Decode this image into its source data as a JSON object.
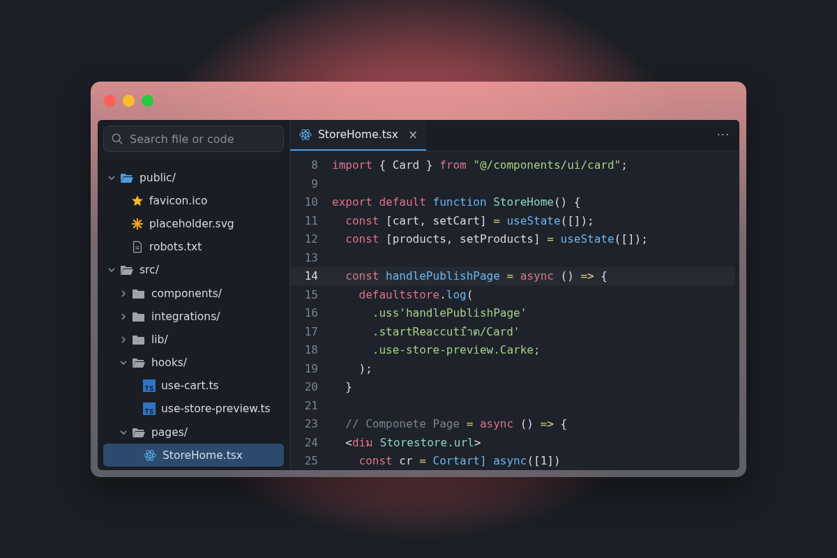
{
  "window": {
    "controls": [
      {
        "kind": "close"
      },
      {
        "kind": "minimize"
      },
      {
        "kind": "zoom"
      }
    ]
  },
  "sidebar": {
    "search": {
      "placeholder": "Search file or code"
    },
    "tree": [
      {
        "name": "public/",
        "kind": "folder",
        "color": "#4d9de0",
        "expanded": true,
        "selected": false,
        "children": [
          {
            "name": "favicon.ico",
            "kind": "star",
            "selected": false
          },
          {
            "name": "placeholder.svg",
            "kind": "asterisk",
            "selected": false
          },
          {
            "name": "robots.txt",
            "kind": "text",
            "selected": false
          }
        ]
      },
      {
        "name": "src/",
        "kind": "folder",
        "color": "#9ea3ab",
        "expanded": true,
        "selected": false,
        "children": [
          {
            "name": "components/",
            "kind": "folder",
            "color": "#9ea3ab",
            "expanded": false,
            "selected": false
          },
          {
            "name": "integrations/",
            "kind": "folder",
            "color": "#9ea3ab",
            "expanded": false,
            "selected": false
          },
          {
            "name": "lib/",
            "kind": "folder",
            "color": "#9ea3ab",
            "expanded": false,
            "selected": false
          },
          {
            "name": "hooks/",
            "kind": "folder",
            "color": "#9ea3ab",
            "expanded": true,
            "selected": false,
            "children": [
              {
                "name": "use-cart.ts",
                "kind": "ts",
                "selected": false
              },
              {
                "name": "use-store-preview.ts",
                "kind": "ts",
                "selected": false
              }
            ]
          },
          {
            "name": "pages/",
            "kind": "folder",
            "color": "#9ea3ab",
            "expanded": true,
            "selected": false,
            "children": [
              {
                "name": "StoreHome.tsx",
                "kind": "react",
                "selected": true
              }
            ]
          }
        ]
      }
    ]
  },
  "editor": {
    "tabs": [
      {
        "label": "StoreHome.tsx",
        "selected": true,
        "close": "×"
      }
    ],
    "more": "···",
    "lines": [
      {
        "number": "8",
        "current": false,
        "tokens": [
          {
            "text": "import",
            "kind": "kw"
          },
          {
            "text": " { Card } ",
            "kind": "plain"
          },
          {
            "text": "from",
            "kind": "kw"
          },
          {
            "text": " \"@/components/ui/card\"",
            "kind": "str"
          },
          {
            "text": ";",
            "kind": "plain"
          }
        ]
      },
      {
        "number": "9",
        "current": false
      },
      {
        "number": "10",
        "current": false,
        "tokens": [
          {
            "text": "export default ",
            "kind": "kw"
          },
          {
            "text": "function ",
            "kind": "fn"
          },
          {
            "text": "StoreHome",
            "kind": "type"
          },
          {
            "text": "() {",
            "kind": "plain"
          }
        ]
      },
      {
        "number": "11",
        "current": false,
        "tokens": [
          {
            "text": "  const",
            "kind": "kw"
          },
          {
            "text": " [cart, setCart] ",
            "kind": "plain"
          },
          {
            "text": "=",
            "kind": "op"
          },
          {
            "text": " useState",
            "kind": "fn"
          },
          {
            "text": "([]);",
            "kind": "plain"
          }
        ]
      },
      {
        "number": "12",
        "current": false,
        "tokens": [
          {
            "text": "  const",
            "kind": "kw"
          },
          {
            "text": " [products, setProducts] ",
            "kind": "plain"
          },
          {
            "text": "=",
            "kind": "op"
          },
          {
            "text": " useState",
            "kind": "fn"
          },
          {
            "text": "([]);",
            "kind": "plain"
          }
        ]
      },
      {
        "number": "13",
        "current": false
      },
      {
        "number": "14",
        "current": true,
        "tokens": [
          {
            "text": "  const",
            "kind": "kw"
          },
          {
            "text": " handlePublishPage",
            "kind": "fn"
          },
          {
            "text": " = ",
            "kind": "op"
          },
          {
            "text": "async",
            "kind": "kw"
          },
          {
            "text": " () ",
            "kind": "plain"
          },
          {
            "text": "=>",
            "kind": "op"
          },
          {
            "text": " {",
            "kind": "plain"
          }
        ]
      },
      {
        "number": "15",
        "current": false,
        "tokens": [
          {
            "text": "    defaultstore",
            "kind": "kw"
          },
          {
            "text": ".",
            "kind": "plain"
          },
          {
            "text": "log",
            "kind": "fn"
          },
          {
            "text": "(",
            "kind": "plain"
          }
        ]
      },
      {
        "number": "16",
        "current": false,
        "tokens": [
          {
            "text": "      .uss'handlePublishPage'",
            "kind": "str"
          }
        ]
      },
      {
        "number": "17",
        "current": false,
        "tokens": [
          {
            "text": "      .startReaccutiำต/Card'",
            "kind": "str"
          }
        ]
      },
      {
        "number": "18",
        "current": false,
        "tokens": [
          {
            "text": "      .use-store-preview.Carke;",
            "kind": "str"
          }
        ]
      },
      {
        "number": "19",
        "current": false,
        "tokens": [
          {
            "text": "    );",
            "kind": "plain"
          }
        ]
      },
      {
        "number": "20",
        "current": false,
        "tokens": [
          {
            "text": "  }",
            "kind": "plain"
          }
        ]
      },
      {
        "number": "21",
        "current": false
      },
      {
        "number": "23",
        "current": false,
        "tokens": [
          {
            "text": "  // Componete Page ",
            "kind": "comment"
          },
          {
            "text": "=",
            "kind": "op"
          },
          {
            "text": " async",
            "kind": "kw"
          },
          {
            "text": " () ",
            "kind": "plain"
          },
          {
            "text": "=>",
            "kind": "op"
          },
          {
            "text": " {",
            "kind": "plain"
          }
        ]
      },
      {
        "number": "24",
        "current": false,
        "tokens": [
          {
            "text": "  <",
            "kind": "plain"
          },
          {
            "text": "diม",
            "kind": "kw"
          },
          {
            "text": " Storestore.url",
            "kind": "type"
          },
          {
            "text": ">",
            "kind": "plain"
          }
        ]
      },
      {
        "number": "25",
        "current": false,
        "tokens": [
          {
            "text": "    const",
            "kind": "kw"
          },
          {
            "text": " cr ",
            "kind": "plain"
          },
          {
            "text": "=",
            "kind": "op"
          },
          {
            "text": " Cortart] async",
            "kind": "fn"
          },
          {
            "text": "([1])",
            "kind": "plain"
          }
        ]
      }
    ]
  }
}
